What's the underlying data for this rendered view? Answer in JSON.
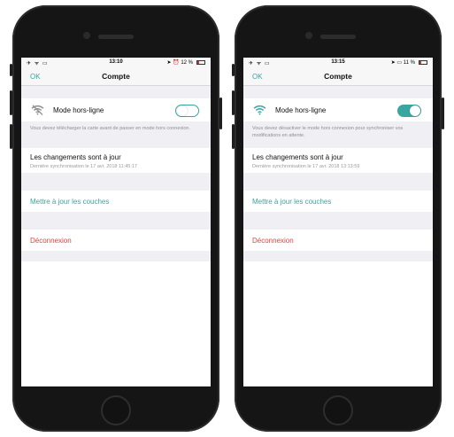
{
  "phones": [
    {
      "status": {
        "left": "✈ ᯤ ▭",
        "time": "13:10",
        "right": "➤ ⏰ 12 %"
      },
      "nav": {
        "back": "OK",
        "title": "Compte"
      },
      "offline": {
        "label": "Mode hors-ligne",
        "toggle": "off",
        "hint": "Vous devez télécharger la carte avant de passer en mode hors connexion."
      },
      "sync": {
        "title": "Les changements sont à jour",
        "subtitle": "Dernière synchronisation le 17 avr. 2018 11:45:17"
      },
      "layers": {
        "label": "Mettre à jour les couches"
      },
      "logout": {
        "label": "Déconnexion"
      }
    },
    {
      "status": {
        "left": "✈ ᯤ ▭",
        "time": "13:15",
        "right": "➤ ▭ 11 %"
      },
      "nav": {
        "back": "OK",
        "title": "Compte"
      },
      "offline": {
        "label": "Mode hors-ligne",
        "toggle": "on",
        "hint": "Vous devez désactiver le mode hors connexion pour synchroniser vos modifications en attente."
      },
      "sync": {
        "title": "Les changements sont à jour",
        "subtitle": "Dernière synchronisation le 17 avr. 2018 13:13:59"
      },
      "layers": {
        "label": "Mettre à jour les couches"
      },
      "logout": {
        "label": "Déconnexion"
      }
    }
  ],
  "colors": {
    "accent": "#39a6a1",
    "danger": "#e0433a",
    "wifi_off": "#8e8e93"
  },
  "icons": {
    "wifi_off": "wifi-off-icon",
    "wifi_on": "wifi-icon"
  }
}
